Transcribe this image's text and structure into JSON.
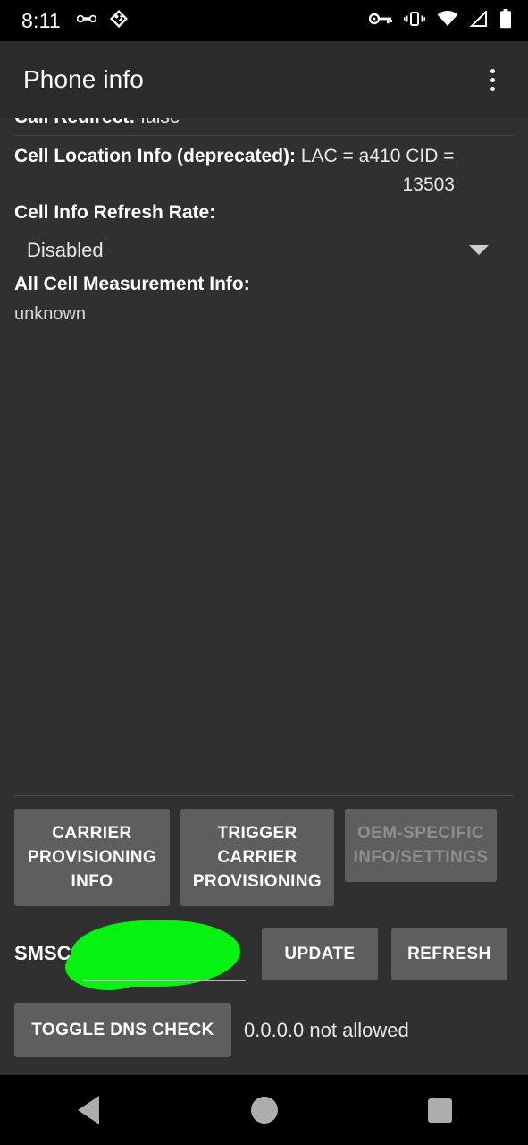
{
  "status_bar": {
    "time": "8:11",
    "left_icons": [
      "link-icon",
      "diamond-nav-icon"
    ],
    "right_icons": [
      "vpn-key-icon",
      "vibrate-icon",
      "wifi-icon",
      "cellular-signal-icon",
      "battery-icon"
    ],
    "background": "#000000"
  },
  "app_bar": {
    "title": "Phone info",
    "overflow_menu": "overflow-menu-icon",
    "background": "#2b2b2b"
  },
  "info": {
    "rows": [
      {
        "key": "Call Redirect:",
        "value": " false"
      }
    ],
    "cell_location": {
      "key": "Cell Location Info (deprecated):",
      "value": " LAC = a410   CID =",
      "value_wrapped": "13503"
    },
    "refresh_rate": {
      "label": "Cell Info Refresh Rate:",
      "selected": "Disabled",
      "arrow": "chevron-down-icon"
    },
    "measurement": {
      "label": "All Cell Measurement Info:",
      "value": "unknown"
    }
  },
  "actions": {
    "carrier_provisioning_info": "CARRIER PROVISIONING INFO",
    "trigger_carrier_provisioning": "TRIGGER CARRIER PROVISIONING",
    "oem_specific": "OEM-SPECIFIC INFO/SETTINGS",
    "oem_specific_enabled": false
  },
  "smsc": {
    "label": "SMSC:",
    "value": "",
    "redacted": true,
    "redaction_color": "#06f312",
    "update_label": "UPDATE",
    "refresh_label": "REFRESH"
  },
  "dns": {
    "toggle_label": "TOGGLE DNS CHECK",
    "status": "0.0.0.0 not allowed"
  },
  "nav_bar": {
    "back": "back-icon",
    "home": "home-icon",
    "recents": "recents-icon"
  }
}
